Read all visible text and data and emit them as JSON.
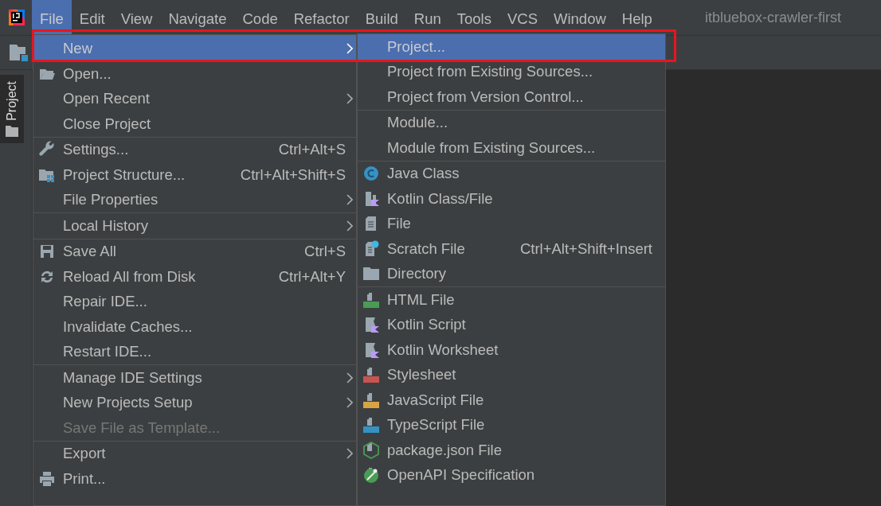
{
  "window": {
    "title": "itbluebox-crawler-first"
  },
  "menubar": [
    {
      "label": "File",
      "selected": true
    },
    {
      "label": "Edit",
      "selected": false
    },
    {
      "label": "View",
      "selected": false
    },
    {
      "label": "Navigate",
      "selected": false
    },
    {
      "label": "Code",
      "selected": false
    },
    {
      "label": "Refactor",
      "selected": false
    },
    {
      "label": "Build",
      "selected": false
    },
    {
      "label": "Run",
      "selected": false
    },
    {
      "label": "Tools",
      "selected": false
    },
    {
      "label": "VCS",
      "selected": false
    },
    {
      "label": "Window",
      "selected": false
    },
    {
      "label": "Help",
      "selected": false
    }
  ],
  "tool_window_tabs": [
    {
      "label": "Project",
      "selected": true
    }
  ],
  "file_menu": {
    "groups": [
      [
        {
          "label": "New",
          "submenu": true,
          "selected": true,
          "disabled": false
        },
        {
          "label": "Open...",
          "submenu": false,
          "selected": false,
          "disabled": false
        },
        {
          "label": "Open Recent",
          "submenu": true,
          "selected": false,
          "disabled": false
        },
        {
          "label": "Close Project",
          "submenu": false,
          "selected": false,
          "disabled": false
        }
      ],
      [
        {
          "label": "Settings...",
          "shortcut": "Ctrl+Alt+S",
          "submenu": false,
          "selected": false,
          "disabled": false
        },
        {
          "label": "Project Structure...",
          "shortcut": "Ctrl+Alt+Shift+S",
          "submenu": false,
          "selected": false,
          "disabled": false
        },
        {
          "label": "File Properties",
          "submenu": true,
          "selected": false,
          "disabled": false
        }
      ],
      [
        {
          "label": "Local History",
          "submenu": true,
          "selected": false,
          "disabled": false
        }
      ],
      [
        {
          "label": "Save All",
          "shortcut": "Ctrl+S",
          "submenu": false,
          "selected": false,
          "disabled": false
        },
        {
          "label": "Reload All from Disk",
          "shortcut": "Ctrl+Alt+Y",
          "submenu": false,
          "selected": false,
          "disabled": false
        },
        {
          "label": "Repair IDE...",
          "submenu": false,
          "selected": false,
          "disabled": false
        },
        {
          "label": "Invalidate Caches...",
          "submenu": false,
          "selected": false,
          "disabled": false
        },
        {
          "label": "Restart IDE...",
          "submenu": false,
          "selected": false,
          "disabled": false
        }
      ],
      [
        {
          "label": "Manage IDE Settings",
          "submenu": true,
          "selected": false,
          "disabled": false
        },
        {
          "label": "New Projects Setup",
          "submenu": true,
          "selected": false,
          "disabled": false
        },
        {
          "label": "Save File as Template...",
          "submenu": false,
          "selected": false,
          "disabled": true
        }
      ],
      [
        {
          "label": "Export",
          "submenu": true,
          "selected": false,
          "disabled": false
        },
        {
          "label": "Print...",
          "submenu": false,
          "selected": false,
          "disabled": false
        }
      ]
    ]
  },
  "new_submenu": {
    "groups": [
      [
        {
          "label": "Project...",
          "selected": true
        },
        {
          "label": "Project from Existing Sources...",
          "selected": false
        },
        {
          "label": "Project from Version Control...",
          "selected": false
        }
      ],
      [
        {
          "label": "Module...",
          "selected": false
        },
        {
          "label": "Module from Existing Sources...",
          "selected": false
        }
      ],
      [
        {
          "label": "Java Class",
          "selected": false
        },
        {
          "label": "Kotlin Class/File",
          "selected": false
        },
        {
          "label": "File",
          "selected": false
        },
        {
          "label": "Scratch File",
          "shortcut": "Ctrl+Alt+Shift+Insert",
          "selected": false
        },
        {
          "label": "Directory",
          "selected": false
        }
      ],
      [
        {
          "label": "HTML File",
          "selected": false
        },
        {
          "label": "Kotlin Script",
          "selected": false
        },
        {
          "label": "Kotlin Worksheet",
          "selected": false
        },
        {
          "label": "Stylesheet",
          "selected": false
        },
        {
          "label": "JavaScript File",
          "selected": false
        },
        {
          "label": "TypeScript File",
          "selected": false
        },
        {
          "label": "package.json File",
          "selected": false
        },
        {
          "label": "OpenAPI Specification",
          "selected": false
        }
      ]
    ]
  }
}
